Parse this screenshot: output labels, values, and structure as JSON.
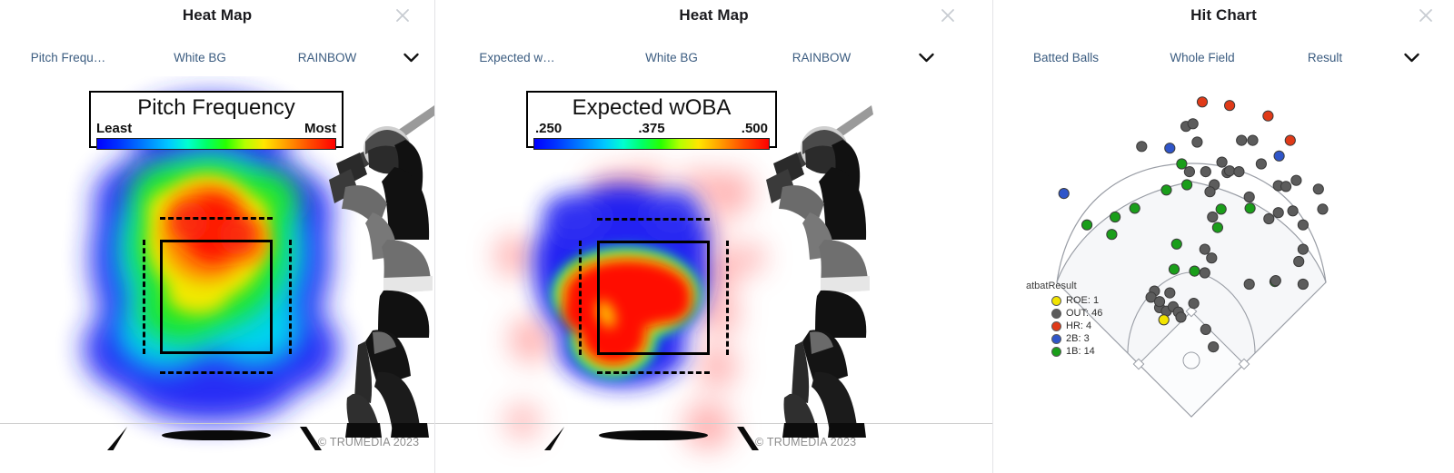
{
  "panels": [
    {
      "id": "heat-map-pitch-frequency",
      "title": "Heat Map",
      "close_label": "×",
      "options": [
        {
          "name": "metric",
          "label": "Pitch Frequ…"
        },
        {
          "name": "background",
          "label": "White BG"
        },
        {
          "name": "palette",
          "label": "RAINBOW"
        }
      ],
      "caret": "chevron-down-icon",
      "legend": {
        "title": "Pitch Frequency",
        "min_label": "Least",
        "max_label": "Most",
        "mid_label": ""
      },
      "watermark": "© TRUMEDIA 2023"
    },
    {
      "id": "heat-map-expected-woba",
      "title": "Heat Map",
      "close_label": "×",
      "options": [
        {
          "name": "metric",
          "label": "Expected w…"
        },
        {
          "name": "background",
          "label": "White BG"
        },
        {
          "name": "palette",
          "label": "RAINBOW"
        }
      ],
      "caret": "chevron-down-icon",
      "legend": {
        "title": "Expected wOBA",
        "min_label": ".250",
        "mid_label": ".375",
        "max_label": ".500"
      },
      "watermark": "© TRUMEDIA 2023"
    },
    {
      "id": "hit-chart",
      "title": "Hit Chart",
      "close_label": "×",
      "options": [
        {
          "name": "data-set",
          "label": "Batted Balls"
        },
        {
          "name": "field-view",
          "label": "Whole Field"
        },
        {
          "name": "color-by",
          "label": "Result"
        }
      ],
      "caret": "chevron-down-icon"
    }
  ],
  "hit_chart": {
    "legend_title": "atbatResult",
    "legend_items": [
      {
        "key": "ROE",
        "label": "ROE: 1",
        "count": 1,
        "color": "#f2e400"
      },
      {
        "key": "OUT",
        "label": "OUT: 46",
        "count": 46,
        "color": "#5c5c5c"
      },
      {
        "key": "HR",
        "label": "HR: 4",
        "count": 4,
        "color": "#e03a18"
      },
      {
        "key": "2B",
        "label": "2B: 3",
        "count": 3,
        "color": "#2f55c9"
      },
      {
        "key": "1B",
        "label": "1B: 14",
        "count": 14,
        "color": "#1a9e1a"
      }
    ]
  },
  "chart_data": {
    "type": "scatter",
    "title": "Hit Chart",
    "xlabel": "",
    "ylabel": "",
    "xlim": [
      0,
      400
    ],
    "ylim": [
      0,
      360
    ],
    "grid": false,
    "legend_position": "bottom-left",
    "legend_title": "atbatResult",
    "series": [
      {
        "name": "HR: 4",
        "color": "#e03a18",
        "points": [
          [
            200,
            17
          ],
          [
            232,
            21
          ],
          [
            277,
            33
          ],
          [
            303,
            61
          ]
        ]
      },
      {
        "name": "2B: 3",
        "color": "#2f55c9",
        "points": [
          [
            162,
            70
          ],
          [
            290,
            79
          ],
          [
            38,
            122
          ]
        ]
      },
      {
        "name": "1B: 14",
        "color": "#1a9e1a",
        "points": [
          [
            176,
            88
          ],
          [
            182,
            112
          ],
          [
            158,
            118
          ],
          [
            121,
            139
          ],
          [
            98,
            149
          ],
          [
            65,
            158
          ],
          [
            94,
            169
          ],
          [
            170,
            180
          ],
          [
            222,
            140
          ],
          [
            256,
            139
          ],
          [
            218,
            161
          ],
          [
            167,
            209
          ],
          [
            191,
            211
          ],
          [
            285,
            223
          ]
        ]
      },
      {
        "name": "OUT: 46",
        "color": "#5c5c5c",
        "points": [
          [
            181,
            45
          ],
          [
            189,
            42
          ],
          [
            129,
            68
          ],
          [
            194,
            63
          ],
          [
            246,
            61
          ],
          [
            259,
            61
          ],
          [
            223,
            86
          ],
          [
            185,
            97
          ],
          [
            204,
            97
          ],
          [
            229,
            98
          ],
          [
            232,
            96
          ],
          [
            243,
            97
          ],
          [
            269,
            88
          ],
          [
            214,
            112
          ],
          [
            209,
            120
          ],
          [
            255,
            126
          ],
          [
            289,
            113
          ],
          [
            298,
            114
          ],
          [
            310,
            107
          ],
          [
            341,
            140
          ],
          [
            289,
            144
          ],
          [
            306,
            142
          ],
          [
            336,
            117
          ],
          [
            318,
            158
          ],
          [
            278,
            151
          ],
          [
            212,
            149
          ],
          [
            203,
            186
          ],
          [
            211,
            196
          ],
          [
            318,
            186
          ],
          [
            313,
            200
          ],
          [
            203,
            213
          ],
          [
            144,
            234
          ],
          [
            140,
            241
          ],
          [
            162,
            236
          ],
          [
            255,
            226
          ],
          [
            286,
            222
          ],
          [
            318,
            226
          ],
          [
            150,
            253
          ],
          [
            158,
            257
          ],
          [
            166,
            252
          ],
          [
            172,
            258
          ],
          [
            190,
            248
          ],
          [
            213,
            298
          ],
          [
            204,
            278
          ],
          [
            175,
            264
          ],
          [
            150,
            246
          ]
        ]
      },
      {
        "name": "ROE: 1",
        "color": "#f2e400",
        "points": [
          [
            155,
            267
          ]
        ]
      }
    ]
  },
  "heatmaps": {
    "pitch_frequency": {
      "palette": "rainbow",
      "description": "Dense rainbow kernel-density cloud centered on the strike zone, hottest (red) just above zone center"
    },
    "expected_woba": {
      "palette": "rainbow",
      "description": "Blue upper strike zone with a hot red band across the lower-middle of the zone"
    }
  }
}
